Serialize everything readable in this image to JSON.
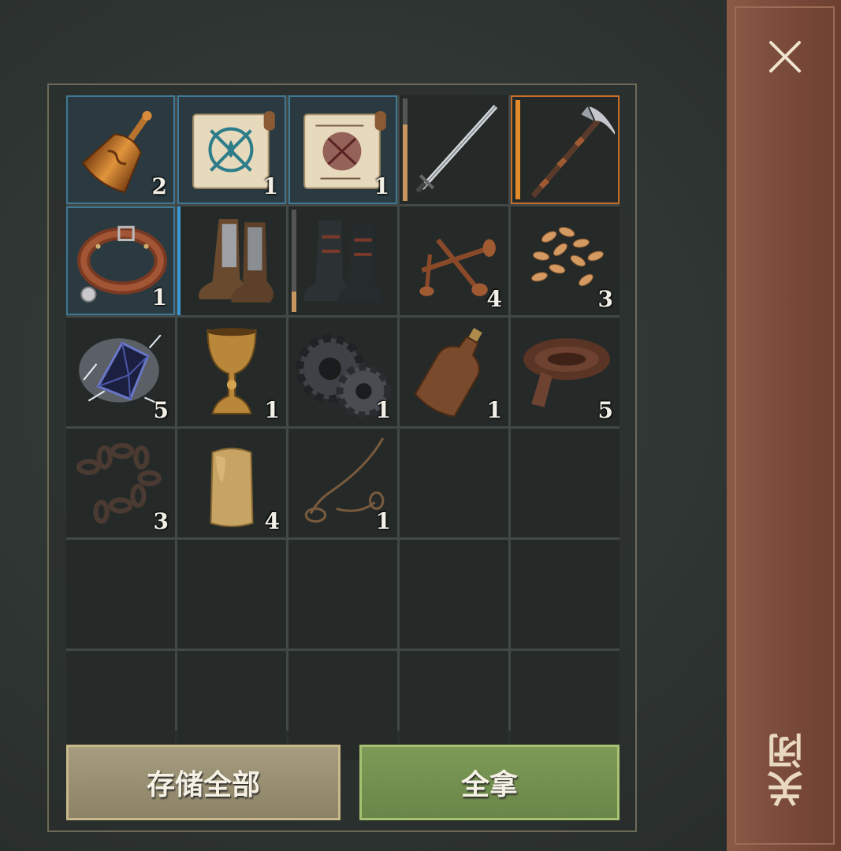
{
  "colors": {
    "quality_blue": "#3b9ad6",
    "quality_orange": "#c76f2a",
    "store_button": "#9a8f73",
    "take_button": "#76924f",
    "close_panel": "#7a4a3a"
  },
  "slots": [
    {
      "item": "bell-icon",
      "qty": "2",
      "frame": "blue"
    },
    {
      "item": "scroll-blue-icon",
      "qty": "1",
      "frame": "blue"
    },
    {
      "item": "scroll-red-icon",
      "qty": "1",
      "frame": "blue"
    },
    {
      "item": "sword-icon",
      "qty": "",
      "frame": "none",
      "durability": 0.75
    },
    {
      "item": "pickaxe-icon",
      "qty": "",
      "frame": "orange",
      "durability": 1.0
    },
    {
      "item": "collar-icon",
      "qty": "1",
      "frame": "blue"
    },
    {
      "item": "plated-boots-icon",
      "qty": "",
      "frame": "blue-left"
    },
    {
      "item": "dark-boots-icon",
      "qty": "",
      "frame": "none",
      "durability": 0.2
    },
    {
      "item": "nails-icon",
      "qty": "4",
      "frame": "none"
    },
    {
      "item": "grain-icon",
      "qty": "3",
      "frame": "none"
    },
    {
      "item": "crystal-icon",
      "qty": "5",
      "frame": "none"
    },
    {
      "item": "goblet-icon",
      "qty": "1",
      "frame": "none"
    },
    {
      "item": "gear-icon",
      "qty": "1",
      "frame": "none"
    },
    {
      "item": "bottle-icon",
      "qty": "1",
      "frame": "none"
    },
    {
      "item": "leather-icon",
      "qty": "5",
      "frame": "none"
    },
    {
      "item": "chain-icon",
      "qty": "3",
      "frame": "none"
    },
    {
      "item": "candle-icon",
      "qty": "4",
      "frame": "none"
    },
    {
      "item": "rope-icon",
      "qty": "1",
      "frame": "none"
    }
  ],
  "buttons": {
    "store_all": "存储全部",
    "take_all": "全拿"
  },
  "side": {
    "close_icon": "close-icon",
    "close_label": "关闭"
  }
}
